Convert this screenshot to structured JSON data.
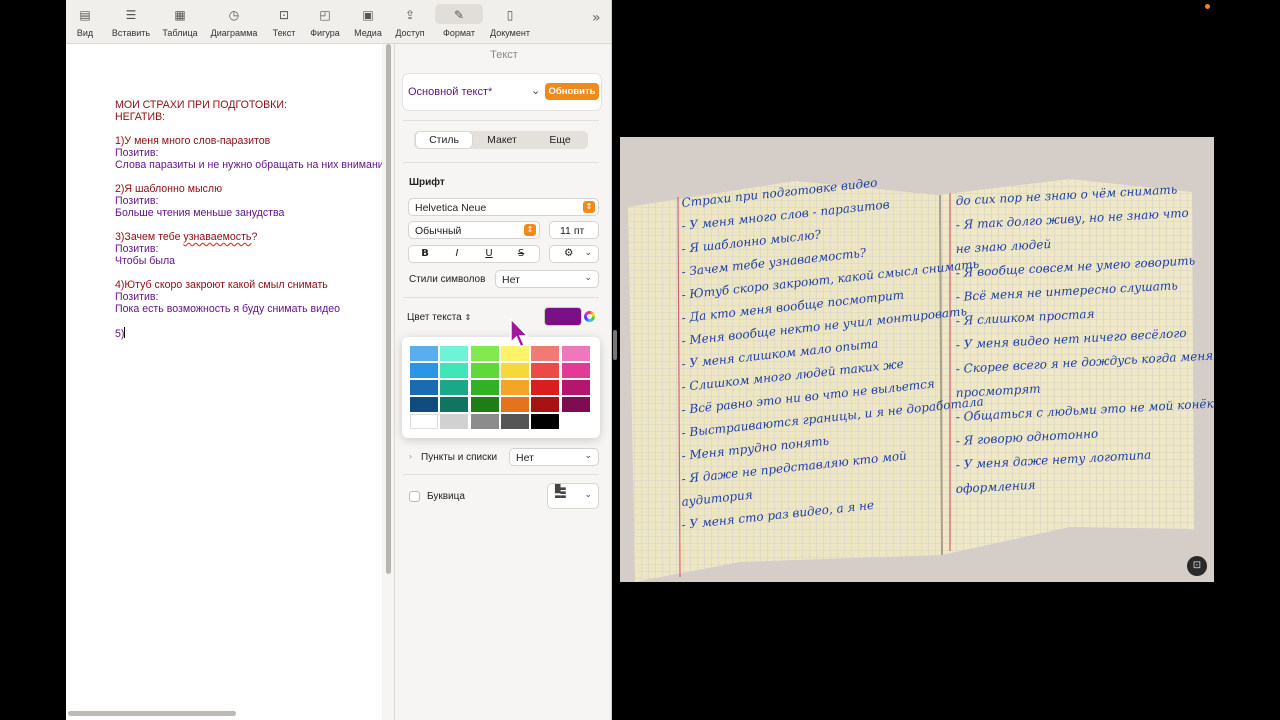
{
  "toolbar": {
    "items": [
      {
        "label": "Вид",
        "icon": "sidebar-icon"
      },
      {
        "label": "Вставить",
        "icon": "insert-list-icon"
      },
      {
        "label": "Таблица",
        "icon": "table-icon"
      },
      {
        "label": "Диаграмма",
        "icon": "chart-clock-icon"
      },
      {
        "label": "Текст",
        "icon": "textbox-icon"
      },
      {
        "label": "Фигура",
        "icon": "shape-icon"
      },
      {
        "label": "Медиа",
        "icon": "photo-icon"
      },
      {
        "label": "Доступ",
        "icon": "share-icon"
      },
      {
        "label": "Формат",
        "icon": "paintbrush-icon"
      },
      {
        "label": "Документ",
        "icon": "document-icon"
      }
    ]
  },
  "document": {
    "lines": [
      {
        "text": "МОИ СТРАХИ ПРИ ПОДГОТОВКИ:",
        "color": "#8b0f12"
      },
      {
        "text": "НЕГАТИВ:",
        "color": "#8b0f12"
      },
      {
        "text": "",
        "color": "#8b0f12"
      },
      {
        "text": "1)У меня много слов-паразитов",
        "color": "#8b0f12"
      },
      {
        "text": "Позитив:",
        "color": "#661488"
      },
      {
        "text": "Слова паразиты и не нужно обращать на них внимание",
        "color": "#661488"
      },
      {
        "text": "",
        "color": "#661488"
      },
      {
        "text": "2)Я шаблонно мыслю",
        "color": "#8b0f12"
      },
      {
        "text": "Позитив:",
        "color": "#661488"
      },
      {
        "text": "Больше чтения меньше занудства",
        "color": "#661488"
      },
      {
        "text": "",
        "color": "#661488"
      },
      {
        "text": "3)Зачем тебе узнаваемость?",
        "color": "#8b0f12"
      },
      {
        "text": "Позитив:",
        "color": "#661488"
      },
      {
        "text": "Чтобы была",
        "color": "#661488"
      },
      {
        "text": "",
        "color": "#661488"
      },
      {
        "text": "4)Ютуб скоро закроют какой смыл снимать",
        "color": "#8b0f12"
      },
      {
        "text": "Позитив:",
        "color": "#661488"
      },
      {
        "text": "Пока есть возможность я буду снимать видео",
        "color": "#661488"
      },
      {
        "text": "",
        "color": "#661488"
      },
      {
        "text": "5)",
        "color": "#661488"
      }
    ]
  },
  "inspector": {
    "title": "Текст",
    "paragraph_style": "Основной текст*",
    "update_label": "Обновить",
    "tabs": [
      "Стиль",
      "Макет",
      "Еще"
    ],
    "selected_tab": "Стиль",
    "font_heading": "Шрифт",
    "font_name": "Helvetica Neue",
    "font_style": "Обычный",
    "font_size": "11 пт",
    "format_buttons": [
      "B",
      "I",
      "U",
      "S"
    ],
    "char_styles_label": "Стили символов",
    "char_styles_value": "Нет",
    "text_color_label": "Цвет текста",
    "text_color": "#7a0f86",
    "lists_label": "Пункты и списки",
    "lists_value": "Нет",
    "dropcap_label": "Буквица"
  },
  "palette": {
    "rows": [
      [
        "#5aaef0",
        "#6ff3d6",
        "#82ea4e",
        "#fcf36a",
        "#f27a74",
        "#ef77bd"
      ],
      [
        "#2b95e6",
        "#3fe6b8",
        "#5fd83a",
        "#f6d83c",
        "#ee4a45",
        "#e33a97"
      ],
      [
        "#1a6bb1",
        "#1aa888",
        "#33b125",
        "#f2a526",
        "#d91f1d",
        "#b5156f"
      ],
      [
        "#0f4c80",
        "#0f755f",
        "#1f7d16",
        "#e4731b",
        "#a71313",
        "#7e0c51"
      ],
      [
        "#ffffff",
        "#d1d1d1",
        "#8c8c8c",
        "#555555",
        "#000000",
        ""
      ]
    ]
  },
  "notebook": {
    "left_page": [
      "Страхи при подготовке видео",
      "- У меня много слов - паразитов",
      "- Я шаблонно мыслю?",
      "- Зачем тебе узнаваемость?",
      "- Ютуб скоро закроют, какой смысл снимать",
      "- Да кто меня вообще посмотрит",
      "- Меня вообще некто не учил монтировать",
      "- У меня слишком мало опыта",
      "- Слишком много людей таких же",
      "- Всё равно это ни во что не выльется",
      "- Выстраиваются границы, и я не доработала",
      "- Меня трудно понять",
      "- Я даже не представляю кто мой",
      "  аудитория",
      "- У меня сто раз видео, а я не"
    ],
    "right_page": [
      "до сих пор не знаю о чём снимать",
      "- Я так долго живу, но не знаю что",
      "не знаю людей",
      "- Я вообще совсем не умею говорить",
      "- Всё меня не интересно слушать",
      "- Я слишком простая",
      "- У меня видео нет ничего весёлого",
      "- Скорее всего я не дождусь когда меня",
      "просмотрят",
      "- Общаться с людьми это не мой конёк",
      "- Я говорю однотонно",
      "- У меня даже нету логотипа",
      "оформления"
    ]
  }
}
